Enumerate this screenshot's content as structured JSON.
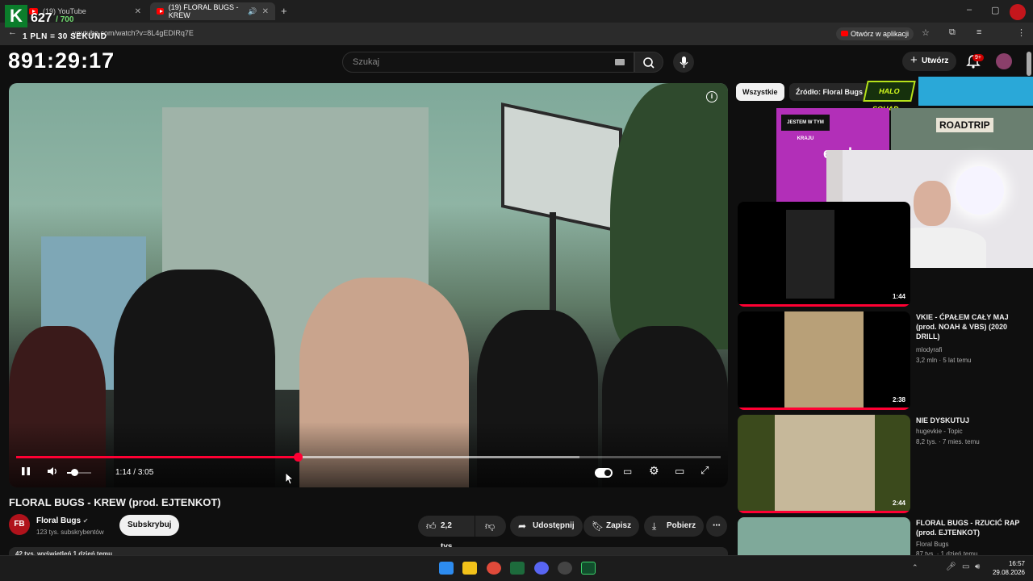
{
  "browser": {
    "tabs": [
      {
        "label": "(19) YouTube",
        "active": false
      },
      {
        "label": "(19) FLORAL BUGS - KREW",
        "active": true
      }
    ],
    "new_tab_icon": "plus-icon",
    "url": "youtube.com/watch?v=8L4gEDIRq7E",
    "open_in_app": "Otwórz w aplikacji"
  },
  "overlay": {
    "logo_letter": "K",
    "count": "627",
    "count_max": "/ 700",
    "rate": "1 PLN = 30 SEKUND",
    "timer": "891:29:17"
  },
  "header": {
    "search_placeholder": "Szukaj",
    "create_label": "Utwórz",
    "notifications_badge": "9+"
  },
  "player": {
    "current_time": "1:14",
    "separator": " / ",
    "duration": "3:05",
    "progress_fraction": 0.4,
    "buffered_fraction": 0.8,
    "volume_fraction": 0.3,
    "colors": {
      "progress": "#ff0033"
    }
  },
  "video": {
    "title": "FLORAL BUGS - KREW (prod. EJTENKOT)",
    "channel": "Floral Bugs",
    "channel_avatar_text": "FB",
    "subscribers": "123 tys. subskrybentów",
    "subscribe_label": "Subskrybuj",
    "likes": "2,2 tys.",
    "share": "Udostępnij",
    "save": "Zapisz",
    "download": "Pobierz",
    "stats_line": "42 tys. wyświetleń  1 dzień temu"
  },
  "sidebar": {
    "chips": [
      "Wszystkie",
      "Źródło: Floral Bugs"
    ],
    "videos": [
      {
        "duration": "1:44",
        "title": "",
        "channel": "",
        "meta": ""
      },
      {
        "duration": "2:38",
        "title": "VKIE - ĆPAŁEM CAŁY MAJ (prod. NOAH & VBS) (2020 DRILL)",
        "channel": "mlodyrafi",
        "meta": "3,2 mln · 5 lat temu"
      },
      {
        "duration": "2:44",
        "title": "NIE DYSKUTUJ",
        "channel": "hugevkie - Topic",
        "meta": "8,2 tys. · 7 mies. temu"
      },
      {
        "duration": "",
        "title": "FLORAL BUGS - RZUCIĆ RAP (prod. EJTENKOT)",
        "channel": "Floral Bugs",
        "meta": "87 tys. · 1 dzień temu"
      }
    ]
  },
  "stream_ads": {
    "eneba": "eneba",
    "banner": "JESTEM W TYM KRAJU",
    "roadtrip": "ROADTRIP",
    "halo": "HALO SQUAD"
  },
  "taskbar": {
    "time": "16:57",
    "date": "29.08.2026"
  }
}
